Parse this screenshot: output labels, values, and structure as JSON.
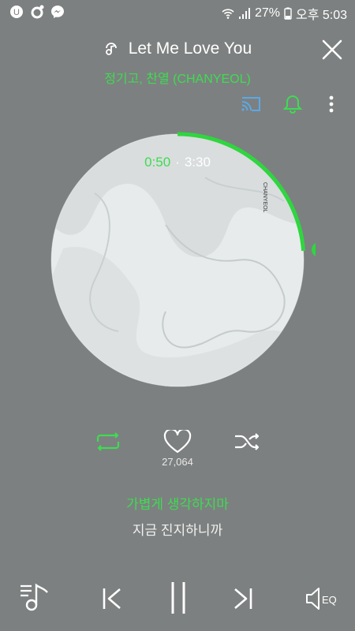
{
  "status_bar": {
    "battery": "27%",
    "time": "오후 5:03"
  },
  "player": {
    "title": "Let Me Love You",
    "artist": "정기고, 찬열 (CHANYEOL)",
    "current_time": "0:50",
    "time_separator": "·",
    "total_time": "3:30",
    "progress": 0.238,
    "album_text": "CHANYEOL",
    "likes": "27,064",
    "lyric_current": "가볍게 생각하지마",
    "lyric_next": "지금 진지하니까",
    "eq_label": "EQ"
  },
  "icons": {
    "cast": "cast-icon",
    "bell": "bell-icon",
    "more": "more-vert-icon",
    "repeat": "repeat-icon",
    "heart": "heart-icon",
    "shuffle": "shuffle-icon",
    "playlist": "playlist-icon",
    "prev": "skip-previous-icon",
    "pause": "pause-icon",
    "next": "skip-next-icon",
    "eq": "equalizer-icon"
  },
  "colors": {
    "accent": "#3ddc52",
    "cast_blue": "#5aa9e6",
    "background": "#7d8080"
  }
}
